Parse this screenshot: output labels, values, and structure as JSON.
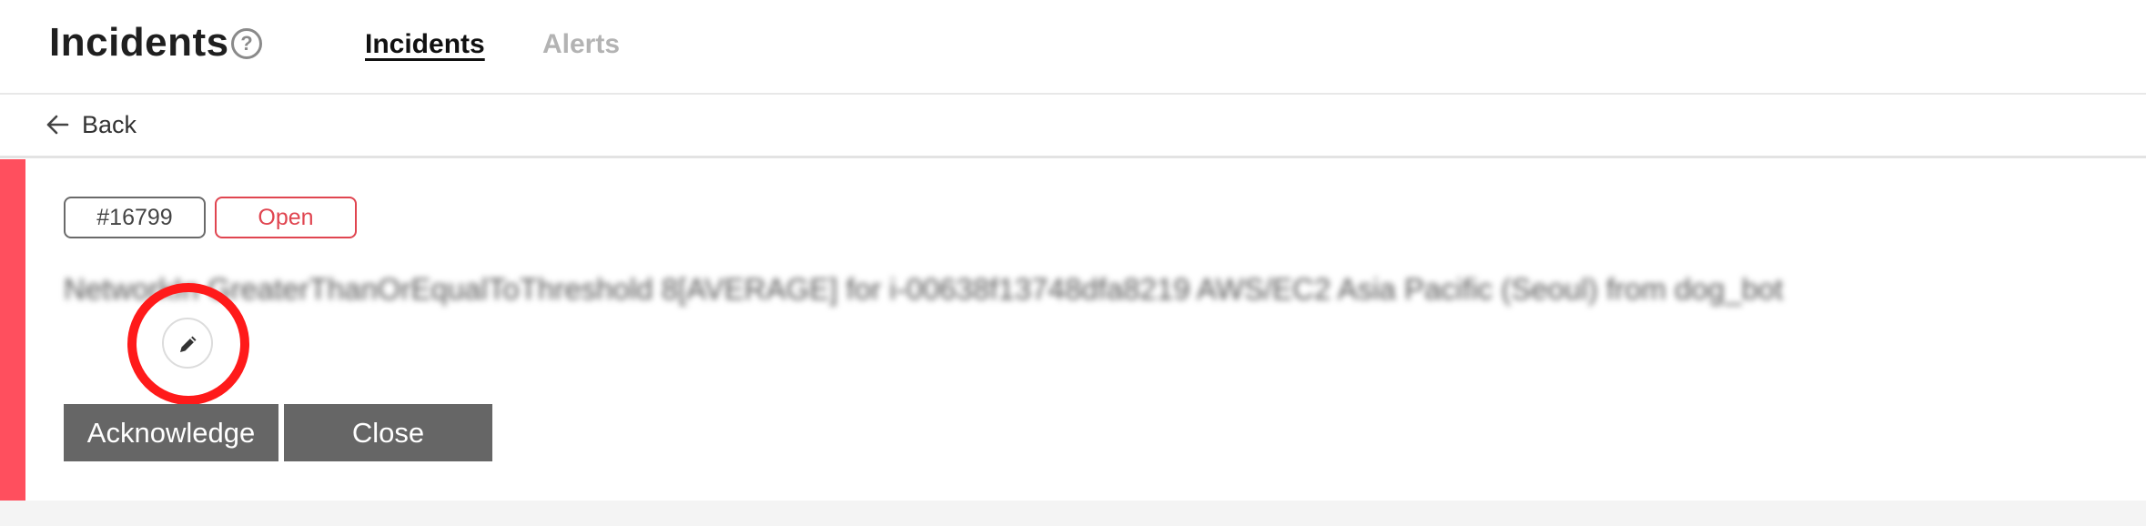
{
  "header": {
    "title": "Incidents",
    "help_icon": "question-circle-icon",
    "tabs": [
      {
        "label": "Incidents",
        "active": true
      },
      {
        "label": "Alerts",
        "active": false
      }
    ]
  },
  "nav": {
    "back_label": "Back",
    "back_icon": "arrow-left-icon"
  },
  "incident": {
    "id": "#16799",
    "status": "Open",
    "title": "NetworkIn GreaterThanOrEqualToThreshold 8[AVERAGE] for i-00638f13748dfa8219 AWS/EC2 Asia Pacific (Seoul) from dog_bot",
    "edit_icon": "pencil-icon",
    "accent_color": "#ff4f5e",
    "status_color": "#e04550"
  },
  "actions": {
    "acknowledge_label": "Acknowledge",
    "close_label": "Close"
  }
}
